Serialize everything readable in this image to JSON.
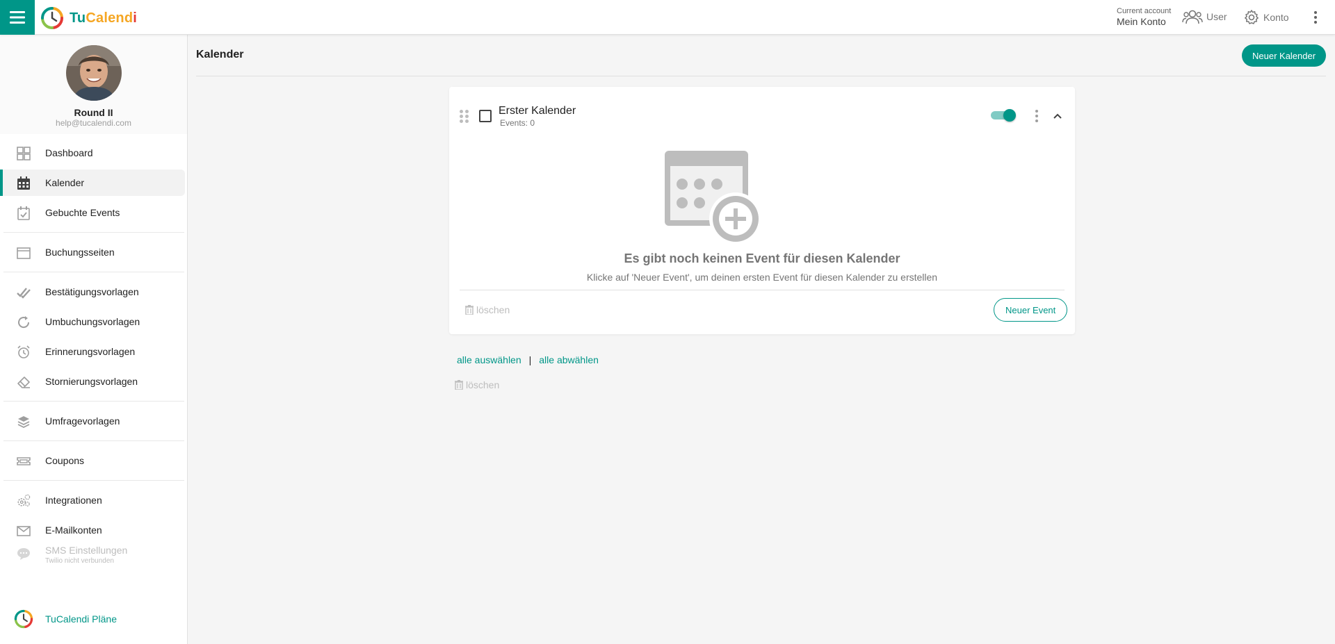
{
  "app": {
    "brand_tu": "Tu",
    "brand_calend": "Calend",
    "brand_i": "i",
    "accent_color": "#009688"
  },
  "header": {
    "account_label": "Current account",
    "account_name": "Mein Konto",
    "user_label": "User",
    "konto_label": "Konto"
  },
  "profile": {
    "name": "Round II",
    "email": "help@tucalendi.com"
  },
  "sidebar": {
    "items": [
      {
        "label": "Dashboard",
        "icon": "dashboard-icon"
      },
      {
        "label": "Kalender",
        "icon": "calendar-icon",
        "active": true
      },
      {
        "label": "Gebuchte Events",
        "icon": "calendar-check-icon"
      },
      {
        "label": "Buchungsseiten",
        "icon": "browser-window-icon"
      },
      {
        "label": "Bestätigungsvorlagen",
        "icon": "double-check-icon"
      },
      {
        "label": "Umbuchungsvorlagen",
        "icon": "refresh-icon"
      },
      {
        "label": "Erinnerungsvorlagen",
        "icon": "alarm-clock-icon"
      },
      {
        "label": "Stornierungsvorlagen",
        "icon": "eraser-icon"
      },
      {
        "label": "Umfragevorlagen",
        "icon": "layers-icon"
      },
      {
        "label": "Coupons",
        "icon": "ticket-icon"
      },
      {
        "label": "Integrationen",
        "icon": "gears-icon"
      },
      {
        "label": "E-Mailkonten",
        "icon": "envelope-icon"
      },
      {
        "label": "SMS Einstellungen",
        "sublabel": "Twilio nicht verbunden",
        "icon": "chat-bubble-icon",
        "disabled": true
      }
    ],
    "plans_label": "TuCalendi Pläne"
  },
  "main": {
    "title": "Kalender",
    "new_calendar_button": "Neuer Kalender",
    "calendar": {
      "name": "Erster Kalender",
      "events_count": "Events: 0",
      "enabled": true,
      "empty_title": "Es gibt noch keinen Event für diesen Kalender",
      "empty_subtitle": "Klicke auf 'Neuer Event', um deinen ersten Event für diesen Kalender zu erstellen",
      "delete_label": "löschen",
      "new_event_button": "Neuer Event"
    },
    "select_all": "alle auswählen",
    "separator": "|",
    "deselect_all": "alle abwählen",
    "bulk_delete_label": "löschen"
  }
}
